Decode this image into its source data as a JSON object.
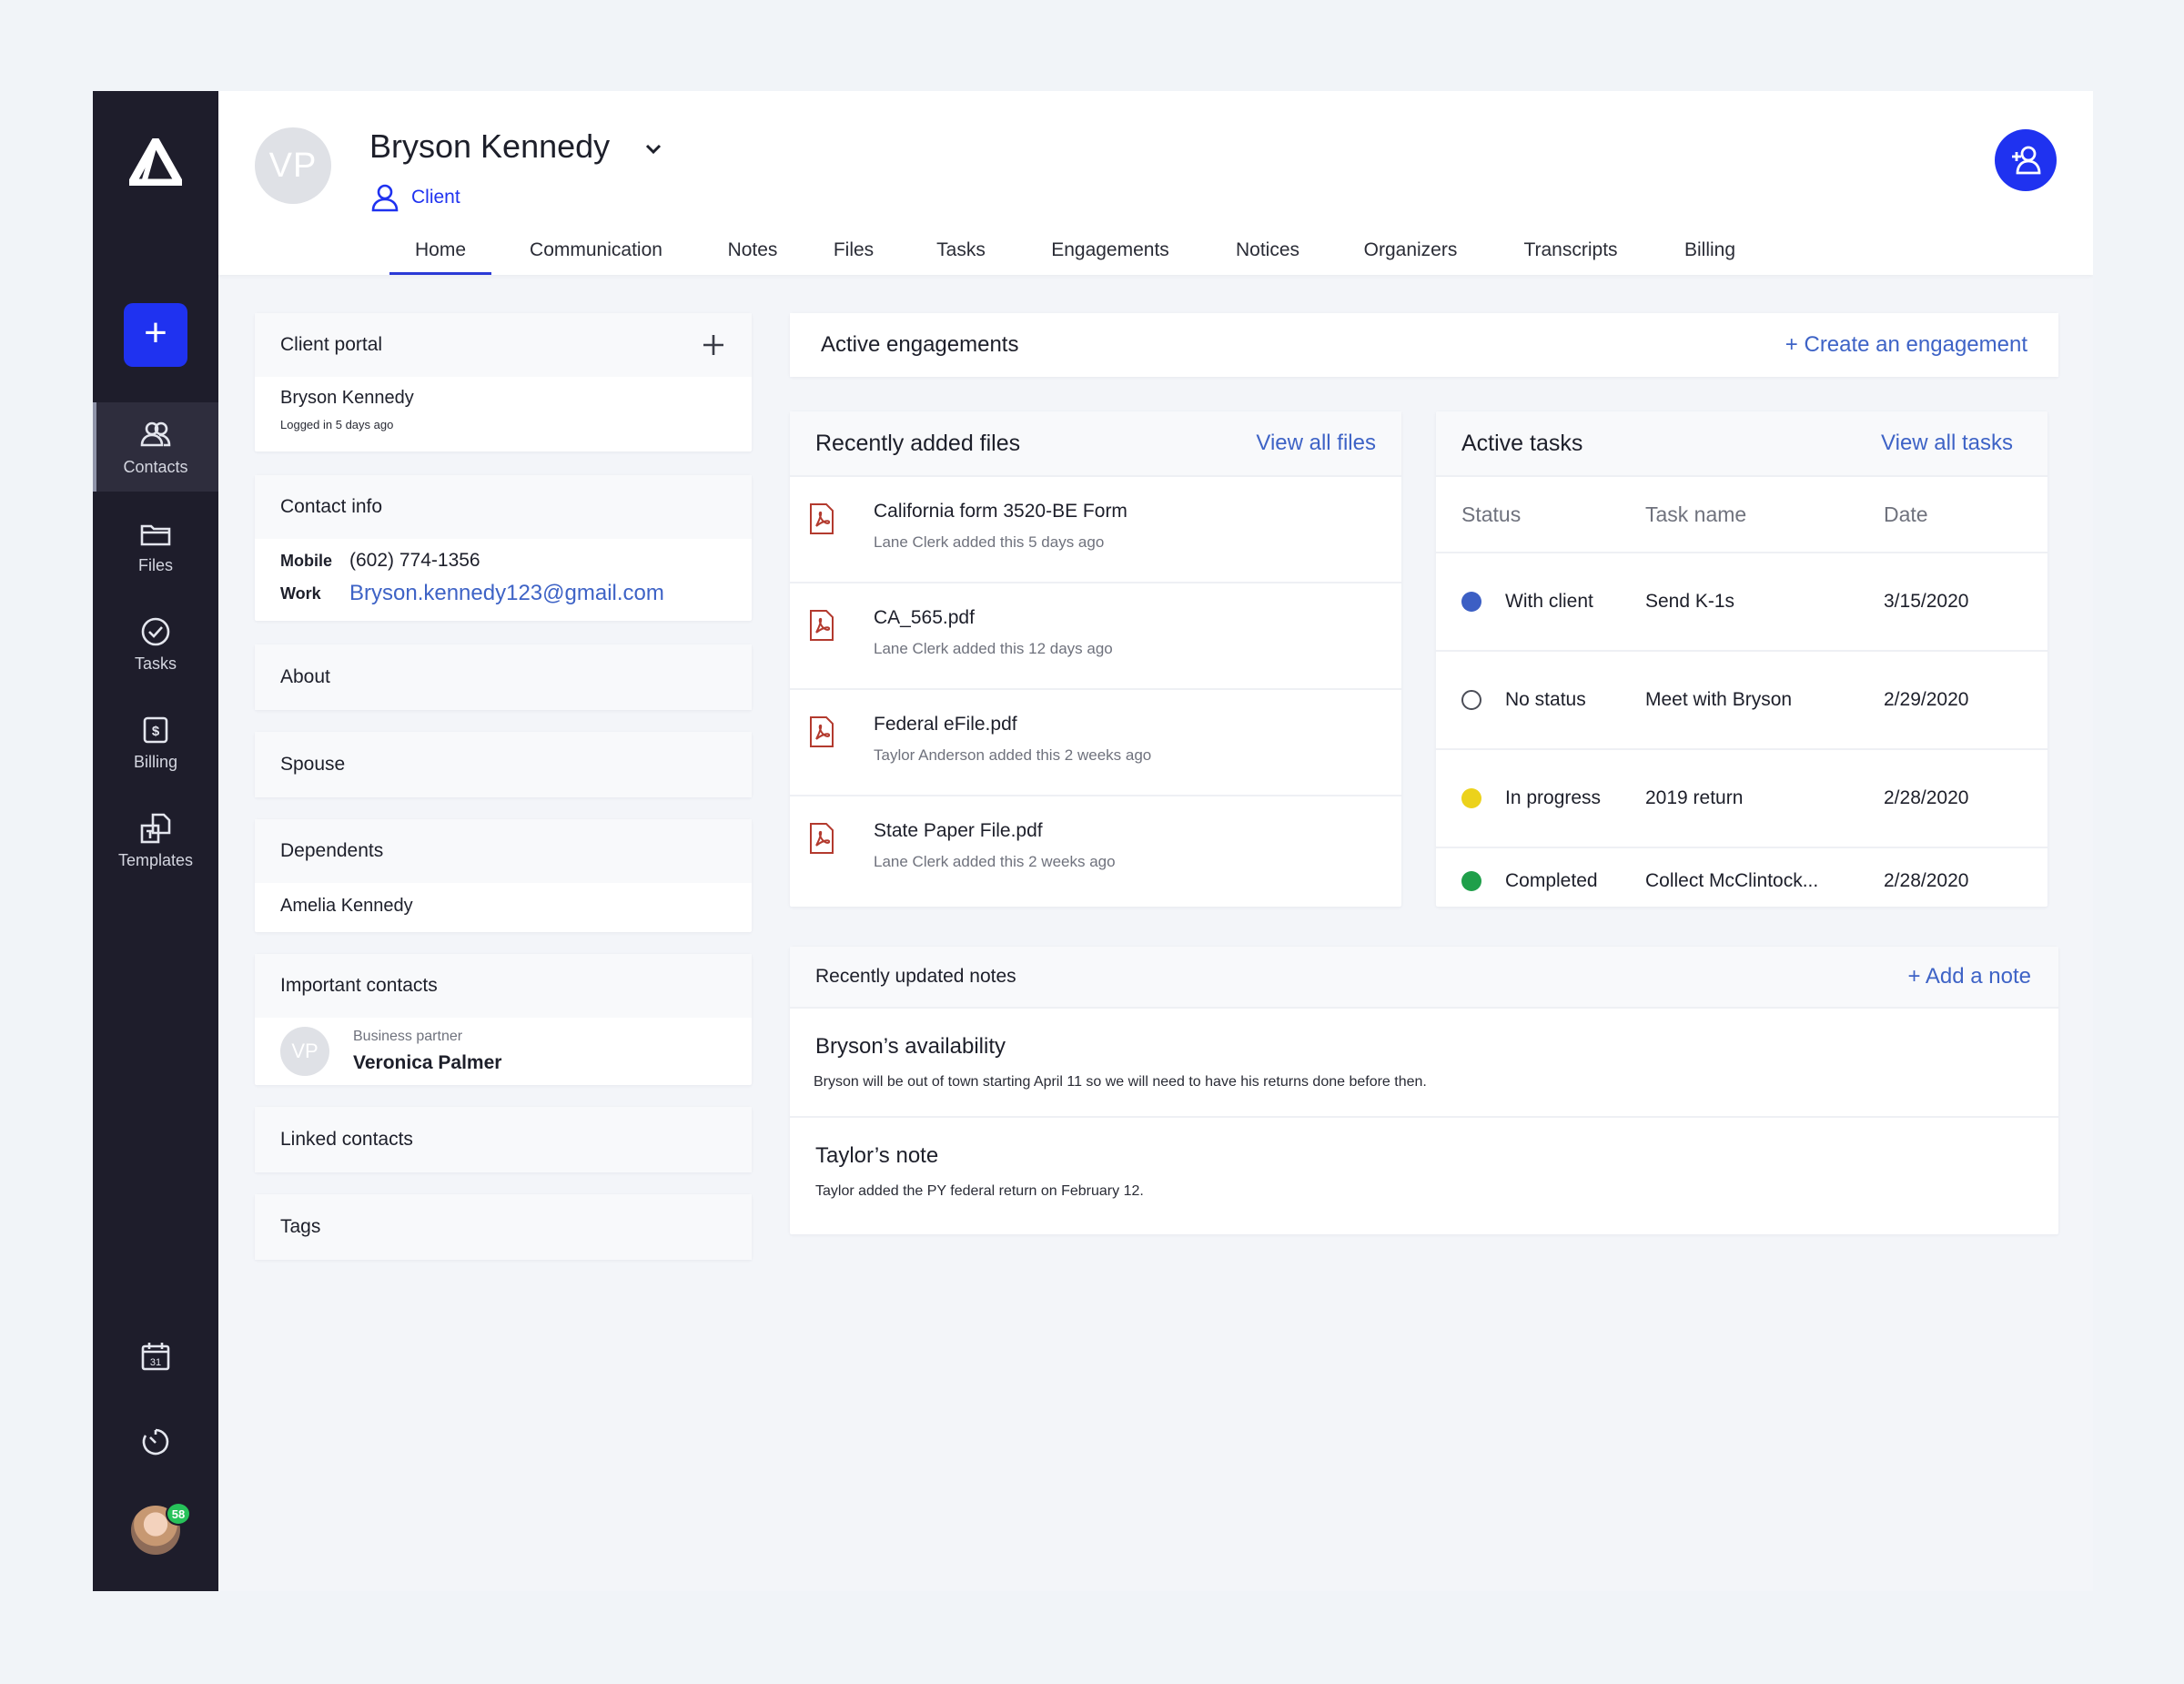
{
  "sidebar": {
    "items": [
      {
        "label": "Contacts",
        "icon": "contacts-icon"
      },
      {
        "label": "Files",
        "icon": "folder-icon"
      },
      {
        "label": "Tasks",
        "icon": "check-circle-icon"
      },
      {
        "label": "Billing",
        "icon": "billing-icon"
      },
      {
        "label": "Templates",
        "icon": "templates-icon"
      }
    ],
    "badge_count": "58"
  },
  "header": {
    "avatar_initials": "VP",
    "client_name": "Bryson Kennedy",
    "client_type": "Client",
    "tabs": [
      "Home",
      "Communication",
      "Notes",
      "Files",
      "Tasks",
      "Engagements",
      "Notices",
      "Organizers",
      "Transcripts",
      "Billing"
    ],
    "active_tab": "Home"
  },
  "client_portal": {
    "title": "Client portal",
    "name": "Bryson Kennedy",
    "status": "Logged in 5 days ago"
  },
  "contact_info": {
    "title": "Contact info",
    "mobile_label": "Mobile",
    "mobile_value": "(602) 774-1356",
    "work_label": "Work",
    "work_value": "Bryson.kennedy123@gmail.com"
  },
  "about": {
    "title": "About"
  },
  "spouse": {
    "title": "Spouse"
  },
  "dependents": {
    "title": "Dependents",
    "name": "Amelia Kennedy"
  },
  "important_contacts": {
    "title": "Important contacts",
    "initials": "VP",
    "role": "Business partner",
    "name": "Veronica Palmer"
  },
  "linked_contacts": {
    "title": "Linked contacts"
  },
  "tags": {
    "title": "Tags"
  },
  "engagements": {
    "title": "Active engagements",
    "action": "+ Create an engagement"
  },
  "files": {
    "title": "Recently added files",
    "action": "View all files",
    "items": [
      {
        "name": "California form 3520-BE Form",
        "meta": "Lane Clerk added this 5 days ago"
      },
      {
        "name": "CA_565.pdf",
        "meta": "Lane Clerk added this 12 days ago"
      },
      {
        "name": "Federal eFile.pdf",
        "meta": "Taylor Anderson added this 2 weeks ago"
      },
      {
        "name": "State Paper File.pdf",
        "meta": "Lane Clerk added this 2 weeks ago"
      }
    ]
  },
  "tasks": {
    "title": "Active tasks",
    "action": "View all tasks",
    "columns": [
      "Status",
      "Task name",
      "Date"
    ],
    "rows": [
      {
        "status": "With client",
        "name": "Send K-1s",
        "date": "3/15/2020",
        "color": "#3c5fc4"
      },
      {
        "status": "No status",
        "name": "Meet with Bryson",
        "date": "2/29/2020",
        "color": "none"
      },
      {
        "status": "In progress",
        "name": "2019 return",
        "date": "2/28/2020",
        "color": "#ecd21b"
      },
      {
        "status": "Completed",
        "name": "Collect McClintock...",
        "date": "2/28/2020",
        "color": "#1f9f4a"
      }
    ]
  },
  "notes": {
    "title": "Recently updated notes",
    "action": "+ Add a note",
    "items": [
      {
        "title": "Bryson’s availability",
        "text": "Bryson will be out of town starting April 11 so we will need to have his returns done before then."
      },
      {
        "title": "Taylor’s note",
        "text": "Taylor added the PY federal return on February 12."
      }
    ]
  },
  "colors": {
    "accent": "#1f32f0",
    "sidebar": "#1e1d2b",
    "link": "#3e63c6"
  }
}
